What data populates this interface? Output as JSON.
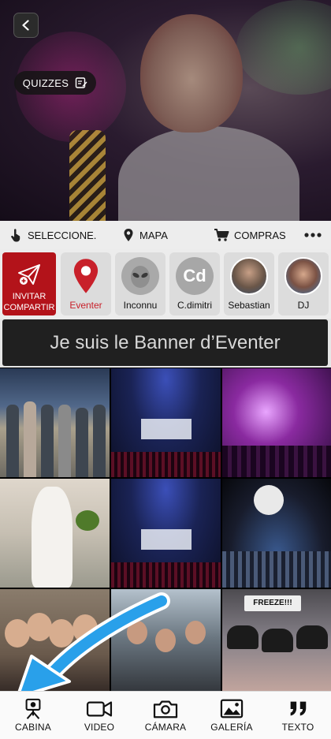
{
  "hero": {
    "quiz_label": "QUIZZES"
  },
  "toolbar": {
    "select_label": "SELECCIONE.",
    "map_label": "MAPA",
    "shop_label": "COMPRAS",
    "more_icon": "more-dots-icon"
  },
  "invite": {
    "line1": "INVITAR",
    "line2": "COMPARTIR"
  },
  "users": [
    {
      "name": "Eventer",
      "avatar": "eventer-pin"
    },
    {
      "name": "Inconnu",
      "avatar": "alien"
    },
    {
      "name": "C.dimitri",
      "avatar": "initials",
      "initials": "Cd"
    },
    {
      "name": "Sebastian",
      "avatar": "photo"
    },
    {
      "name": "DJ",
      "avatar": "photo"
    }
  ],
  "banner": {
    "text": "Je suis le Banner d’Eventer"
  },
  "gallery": {
    "freeze_sign": "FREEZE!!!"
  },
  "bottom_nav": [
    {
      "label": "CABINA",
      "icon": "photo-booth-icon"
    },
    {
      "label": "VIDEO",
      "icon": "video-camera-icon"
    },
    {
      "label": "CÁMARA",
      "icon": "camera-icon"
    },
    {
      "label": "GALERÍA",
      "icon": "gallery-icon"
    },
    {
      "label": "TEXTO",
      "icon": "quote-icon"
    }
  ],
  "colors": {
    "accent_red": "#b3131a",
    "arrow_blue": "#29a0ea",
    "banner_bg": "#202020"
  }
}
